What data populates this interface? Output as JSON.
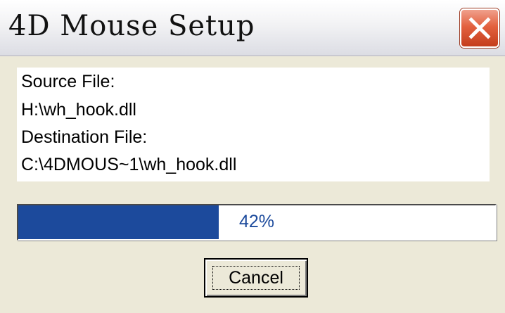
{
  "window": {
    "title": "4D Mouse Setup"
  },
  "titlebar": {
    "close_icon": "close-icon"
  },
  "info": {
    "source_label": "Source File:",
    "source_path": "H:\\wh_hook.dll",
    "destination_label": "Destination File:",
    "destination_path": "C:\\4DMOUS~1\\wh_hook.dll"
  },
  "progress": {
    "value": 42,
    "label": "42%",
    "fill_color": "#1c4a9c"
  },
  "buttons": {
    "cancel_label": "Cancel"
  },
  "colors": {
    "close_button": "#e3613f",
    "dialog_background": "#ece9d8"
  }
}
